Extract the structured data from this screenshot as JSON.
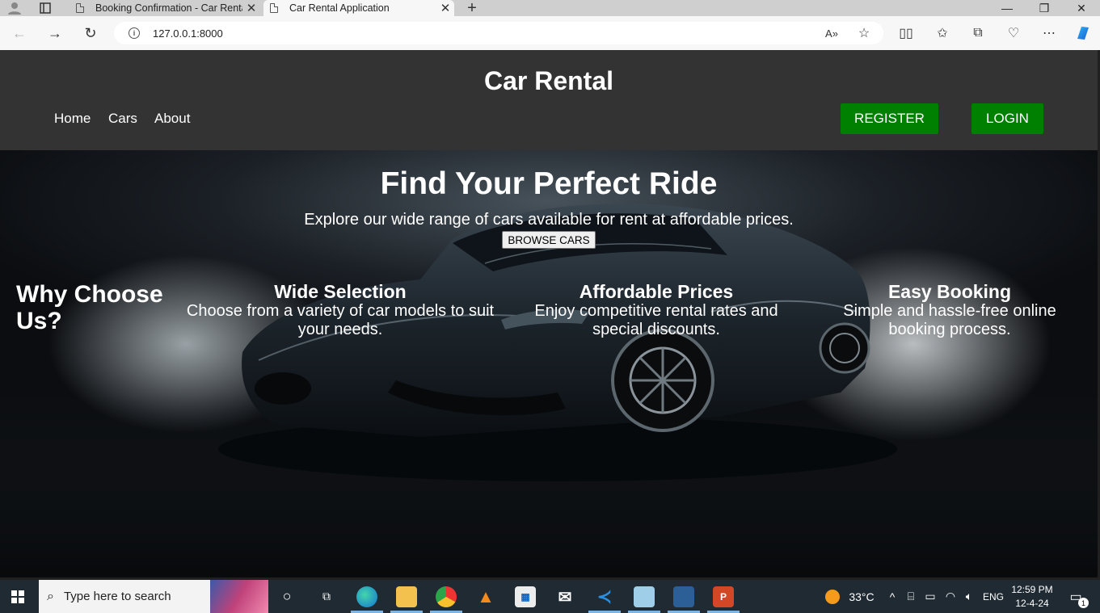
{
  "browser": {
    "tabs": [
      {
        "title": "Booking Confirmation - Car Rental",
        "active": false
      },
      {
        "title": "Car Rental Application",
        "active": true
      }
    ],
    "url": "127.0.0.1:8000"
  },
  "site": {
    "title": "Car Rental",
    "nav": [
      "Home",
      "Cars",
      "About"
    ],
    "register_label": "REGISTER",
    "login_label": "LOGIN",
    "accent_color": "#008000"
  },
  "hero": {
    "title": "Find Your Perfect Ride",
    "subtitle": "Explore our wide range of cars available for rent at affordable prices.",
    "browse_label": "BROWSE CARS",
    "why_title": "Why Choose Us?",
    "features": [
      {
        "title": "Wide Selection",
        "text": "Choose from a variety of car models to suit your needs."
      },
      {
        "title": "Affordable Prices",
        "text": "Enjoy competitive rental rates and special discounts."
      },
      {
        "title": "Easy Booking",
        "text": "Simple and hassle-free online booking process."
      }
    ]
  },
  "taskbar": {
    "search_placeholder": "Type here to search",
    "weather": "33°C",
    "language": "ENG",
    "time": "12:59 PM",
    "date": "12-4-24",
    "notification_count": "1"
  }
}
